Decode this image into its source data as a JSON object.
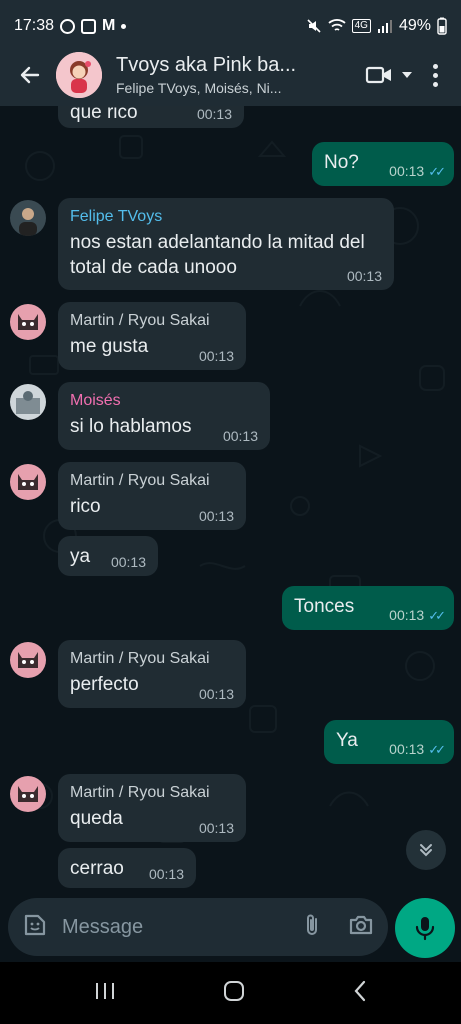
{
  "status_bar": {
    "time": "17:38",
    "battery": "49%",
    "network": "4G"
  },
  "header": {
    "title": "Tvoys aka Pink ba...",
    "subtitle": "Felipe TVoys, Moisés, Ni..."
  },
  "messages": [
    {
      "side": "in",
      "text": "que rico",
      "time": "00:13"
    },
    {
      "side": "out",
      "text": "No?",
      "time": "00:13"
    },
    {
      "side": "in",
      "sender": "Felipe TVoys",
      "text": "nos estan adelantando la mitad del total de cada unooo",
      "time": "00:13"
    },
    {
      "side": "in",
      "sender": "Martin / Ryou Sakai",
      "text": "me gusta",
      "time": "00:13"
    },
    {
      "side": "in",
      "sender": "Moisés",
      "text": "si lo hablamos",
      "time": "00:13"
    },
    {
      "side": "in",
      "sender": "Martin / Ryou Sakai",
      "text": "rico",
      "time": "00:13"
    },
    {
      "side": "in",
      "text": "ya",
      "time": "00:13"
    },
    {
      "side": "out",
      "text": "Tonces",
      "time": "00:13"
    },
    {
      "side": "in",
      "sender": "Martin / Ryou Sakai",
      "text": "perfecto",
      "time": "00:13"
    },
    {
      "side": "out",
      "text": "Ya",
      "time": "00:13"
    },
    {
      "side": "in",
      "sender": "Martin / Ryou Sakai",
      "text": "queda",
      "time": "00:13"
    },
    {
      "side": "in",
      "text": "cerrao",
      "time": "00:13"
    }
  ],
  "composer": {
    "placeholder": "Message"
  },
  "colors": {
    "felipe": "#53bdeb",
    "martin": "#c9d1d5",
    "moises": "#f06fb0",
    "accent": "#00a884",
    "outgoing": "#005c4b",
    "incoming": "#202c33"
  }
}
